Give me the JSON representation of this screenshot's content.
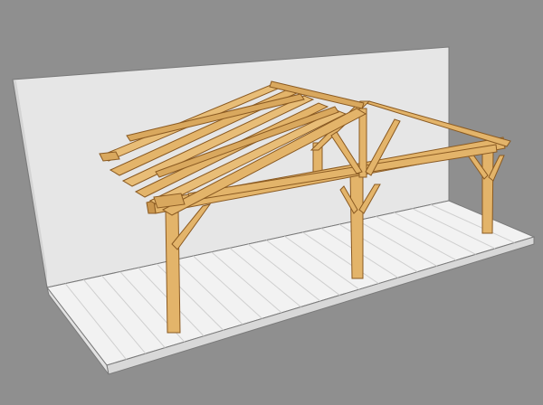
{
  "image": {
    "subject": "3d-render",
    "colors": {
      "background": "#8f8f8f",
      "wall": "#e6e6e6",
      "wall_side": "#cdcdcd",
      "deck": "#f2f2f2",
      "deck_edge": "#d8d8d8",
      "deck_lines": "#c9c9c9",
      "wood": "#e3b46a",
      "wood_dark": "#b9843e",
      "wood_outline": "#8a5a22"
    }
  }
}
